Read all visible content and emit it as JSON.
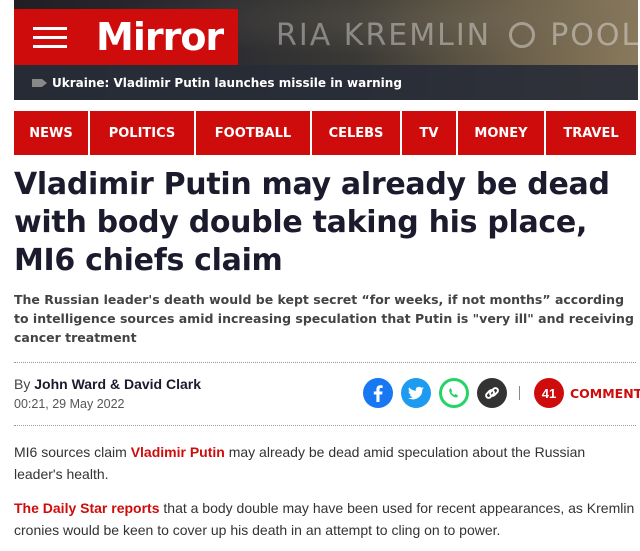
{
  "header": {
    "brand": "Mirror",
    "watermark_left": "RIA",
    "watermark_main": "KREMLIN",
    "watermark_right": "POOL",
    "ticker_text": "Ukraine: Vladimir Putin launches missile in warning"
  },
  "nav": {
    "items": [
      "NEWS",
      "POLITICS",
      "FOOTBALL",
      "CELEBS",
      "TV",
      "MONEY",
      "TRAVEL"
    ]
  },
  "article": {
    "headline": "Vladimir Putin may already be dead with body double taking his place, MI6 chiefs claim",
    "standfirst": "The Russian leader's death would be kept secret “for weeks, if not months” according to intelligence sources amid increasing speculation that Putin is \"very ill\" and receiving cancer treatment",
    "byline_prefix": "By",
    "author_1": "John Ward",
    "author_sep": "&",
    "author_2": "David Clark",
    "date": "00:21, 29 May 2022",
    "comment_count": "41",
    "comments_label": "COMMENTS",
    "p1_a": "MI6 sources claim ",
    "p1_link": "Vladimir Putin",
    "p1_b": " may already be dead amid speculation about the Russian leader's health.",
    "p2_link": "The Daily Star reports",
    "p2_b": " that a body double may have been used for recent appearances, as Kremlin cronies would be keen to cover up his death in an attempt to cling on to power."
  },
  "share_icons": [
    "facebook-icon",
    "twitter-icon",
    "whatsapp-icon",
    "link-icon"
  ],
  "colors": {
    "brand_red": "#cf0c0c",
    "headline": "#1b1b2d",
    "facebook": "#1877f2",
    "twitter": "#1d9bf0",
    "whatsapp": "#25d366"
  }
}
